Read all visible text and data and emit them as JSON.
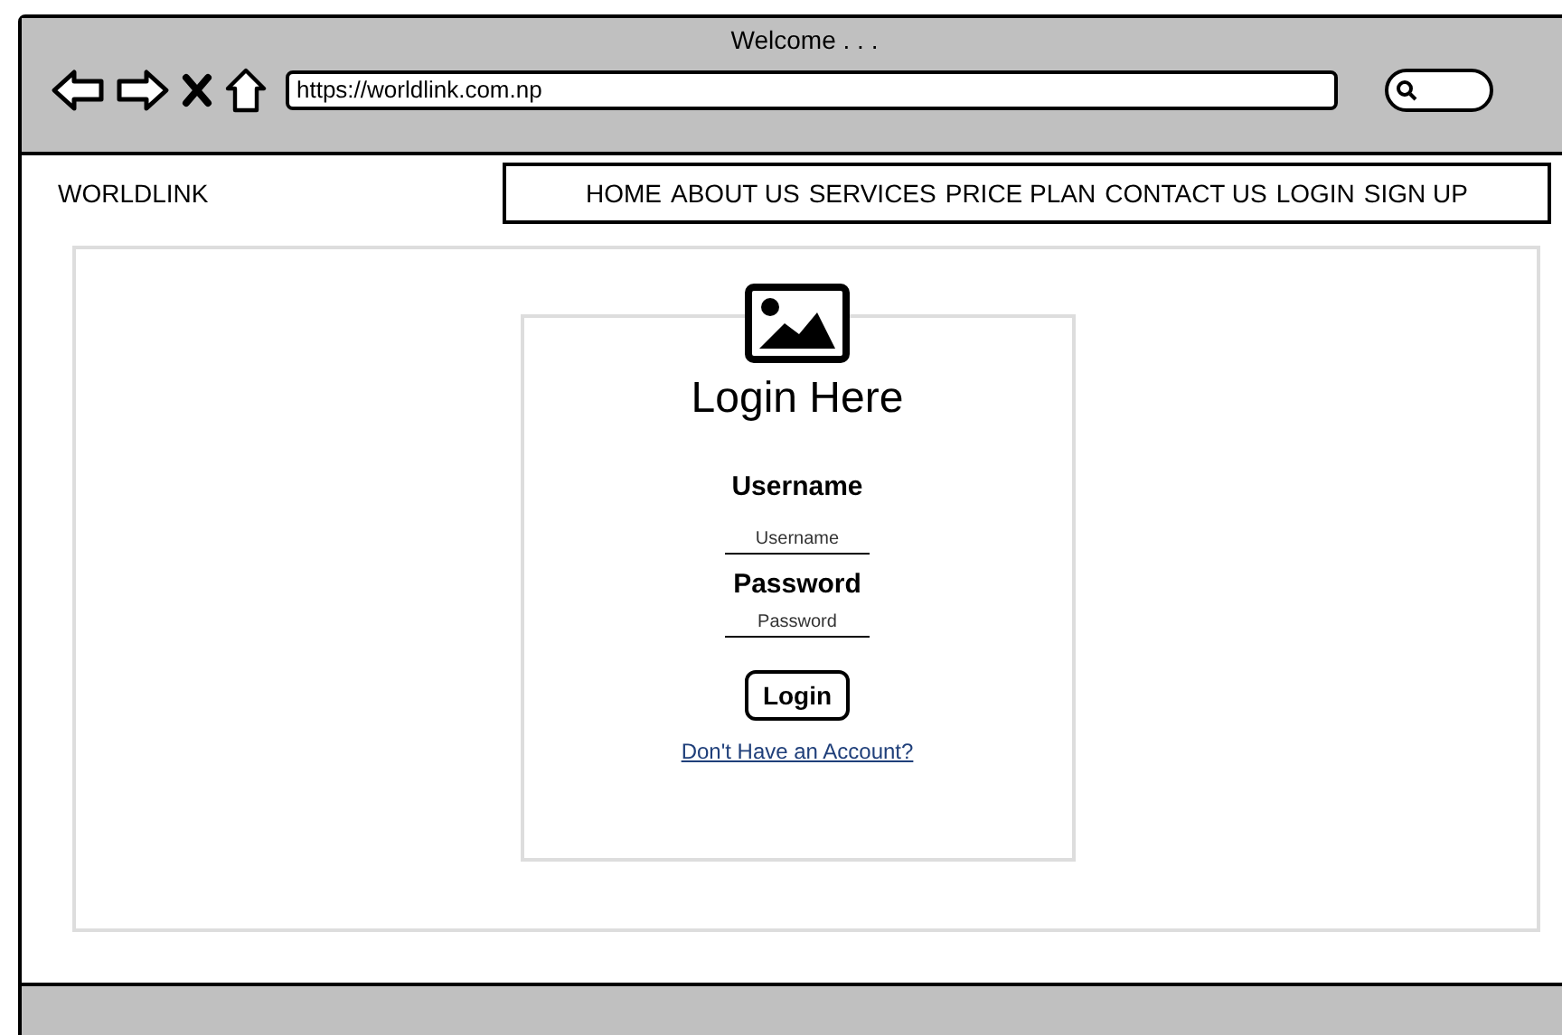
{
  "window": {
    "title": "Welcome . . ."
  },
  "address_bar": {
    "value": "https://worldlink.com.np"
  },
  "site": {
    "brand": "WORLDLINK",
    "nav": [
      {
        "label": "HOME"
      },
      {
        "label": "ABOUT US"
      },
      {
        "label": "SERVICES"
      },
      {
        "label": "PRICE PLAN"
      },
      {
        "label": "CONTACT US"
      },
      {
        "label": "LOGIN"
      },
      {
        "label": "SIGN UP"
      }
    ]
  },
  "login_card": {
    "title": "Login Here",
    "fields": [
      {
        "label": "Username",
        "placeholder": "Username"
      },
      {
        "label": "Password",
        "placeholder": "Password"
      }
    ],
    "button": "Login",
    "link": "Don't Have an Account?"
  }
}
